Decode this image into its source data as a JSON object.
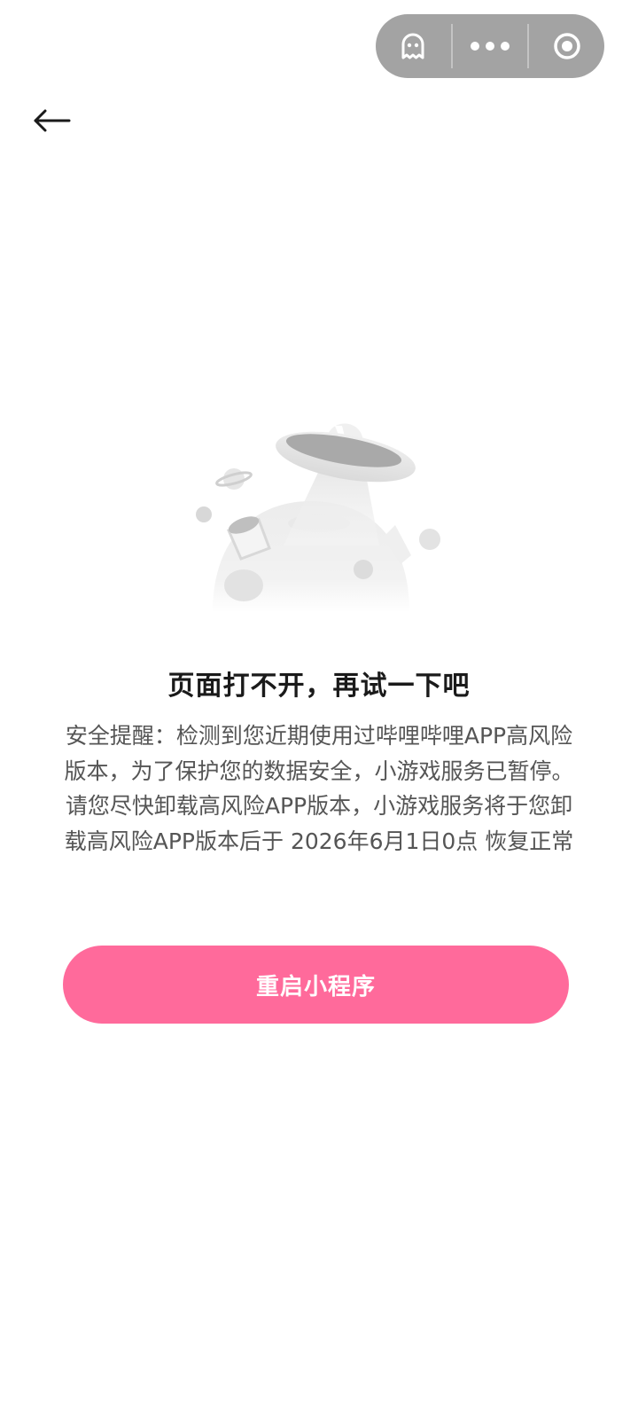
{
  "capsule": {
    "icons": [
      "ghost-icon",
      "more-dots-icon",
      "target-icon"
    ],
    "bg_color": "#a3a3a3"
  },
  "nav": {
    "back_icon": "back-arrow-icon"
  },
  "illustration": {
    "name": "ufo-planet-illustration"
  },
  "error": {
    "title": "页面打不开，再试一下吧",
    "message": "安全提醒：检测到您近期使用过哔哩哔哩APP高风险版本，为了保护您的数据安全，小游戏服务已暂停。请您尽快卸载高风险APP版本，小游戏服务将于您卸载高风险APP版本后于 2026年6月1日0点 恢复正常"
  },
  "actions": {
    "restart_label": "重启小程序",
    "accent_color": "#ff6a9b"
  }
}
